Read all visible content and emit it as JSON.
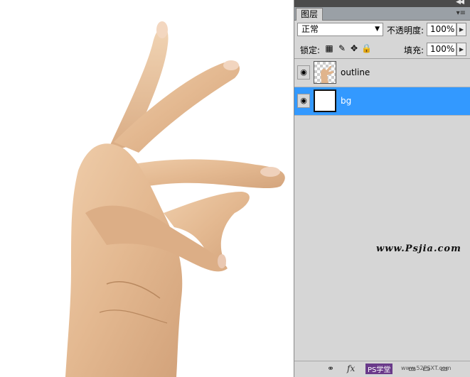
{
  "panel": {
    "tab_label": "图层",
    "blend_mode": "正常",
    "opacity_label": "不透明度:",
    "opacity_value": "100%",
    "lock_label": "锁定:",
    "fill_label": "填充:",
    "fill_value": "100%"
  },
  "layers": [
    {
      "name": "outline",
      "visible": true,
      "selected": false
    },
    {
      "name": "bg",
      "visible": true,
      "selected": true
    }
  ],
  "watermark": "www.Psjia.com",
  "bottom": {
    "brand": "PS学堂",
    "brand_url": "www.52PSXT.com"
  },
  "colors": {
    "selection": "#3399ff",
    "panel_bg": "#d6d6d6"
  },
  "icons": [
    "collapse-icon",
    "panel-menu-icon",
    "eye-icon",
    "lock-transparency-icon",
    "lock-brush-icon",
    "lock-move-icon",
    "lock-all-icon",
    "link-icon",
    "fx-icon",
    "mask-icon",
    "adjustment-icon",
    "group-icon",
    "new-layer-icon",
    "trash-icon"
  ]
}
